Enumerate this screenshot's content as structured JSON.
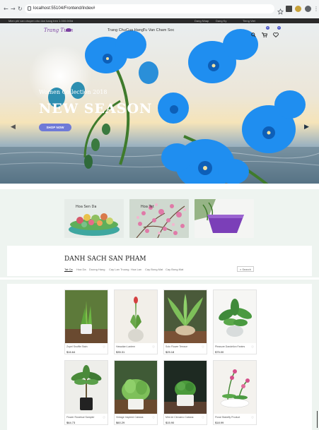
{
  "browser": {
    "url": "localhost:55104/Frontend/Index#"
  },
  "topbar": {
    "left": "Mien phi van chuyen cho don hang tren 1.000.000d",
    "right_links": [
      "Dang Nhap",
      "Dang Ky",
      "Tieng Viet"
    ]
  },
  "header": {
    "logo_text": "Trang Tuan",
    "menu": [
      "Trang Chu",
      "Cua Hang",
      "Tu Van Cham Soc"
    ],
    "cart_count": "0",
    "wishlist_count": "0"
  },
  "hero": {
    "subtitle": "Women Collection 2018",
    "title": "NEW SEASON",
    "button": "SHOP NOW"
  },
  "categories": [
    {
      "label": "Hoa Sen Da"
    },
    {
      "label": "Hoa Tet"
    },
    {
      "label": ""
    }
  ],
  "product_list": {
    "title": "DANH SACH SAN PHAM",
    "filters": [
      "Tat Ca",
      "Hoa Da",
      "Duong Hang",
      "Cay Lan Truong",
      "Hoa Lan",
      "Cay Bong Mat",
      "Cay Bong Mat"
    ],
    "search_label": "Search"
  },
  "products": [
    {
      "name": "Zopel Snuffle Stain",
      "price": "$16.64"
    },
    {
      "name": "Hawaiian Lantern",
      "price": "$35.31"
    },
    {
      "name": "Solo Flower Terrace",
      "price": "$25.18"
    },
    {
      "name": "Pleasure Dandelion Fantes",
      "price": "$75.00"
    },
    {
      "name": "Flower Rosebud Sampler",
      "price": "$64.73"
    },
    {
      "name": "Vintage Inspired Cabana",
      "price": "$60.29"
    },
    {
      "name": "Mini de Cinnamo Cabana",
      "price": "$15.90"
    },
    {
      "name": "Floral Stakefly Product",
      "price": "$18.99"
    }
  ],
  "colors": {
    "accent": "#6f7ad7",
    "section_bg": "#eef4f0",
    "topbar": "#2a2a2a"
  }
}
